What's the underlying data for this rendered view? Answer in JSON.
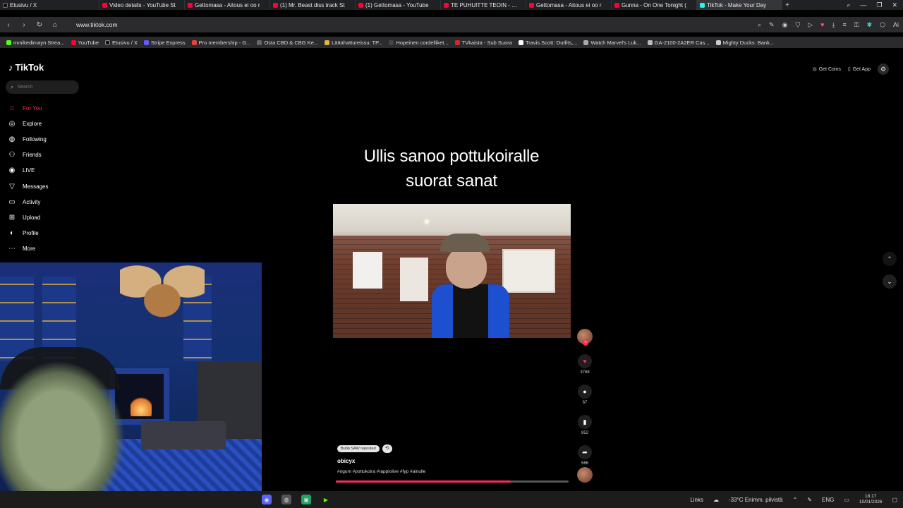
{
  "browser": {
    "tabs": [
      {
        "label": "Etusivu / X",
        "color": "#111111"
      },
      {
        "label": "Video details - YouTube St",
        "color": "#ff0033"
      },
      {
        "label": "Gettomasa - Aitous ei oo r",
        "color": "#ff0033"
      },
      {
        "label": "(1) Mr. Beast diss track St",
        "color": "#ff0033"
      },
      {
        "label": "(1) Gettomasa - YouTube",
        "color": "#ff0033"
      },
      {
        "label": "TE PUHUITTE TEOIN - MIE",
        "color": "#ff0033"
      },
      {
        "label": "Gettomasa - Aitous ei oo r",
        "color": "#ff0033"
      },
      {
        "label": "Gunna - On One Tonight (",
        "color": "#ff0033"
      },
      {
        "label": "TikTok - Make Your Day",
        "color": "#25f4ee",
        "active": true
      }
    ],
    "new_tab": "+",
    "url": "www.tiktok.com",
    "bookmarks": [
      {
        "label": "mmikedimayn Strea...",
        "color": "#53fc18"
      },
      {
        "label": "YouTube",
        "color": "#ff0033"
      },
      {
        "label": "Etusivu / X",
        "color": "#111111"
      },
      {
        "label": "Stripe Express",
        "color": "#635bff"
      },
      {
        "label": "Pro membership - G...",
        "color": "#ea4335"
      },
      {
        "label": "Osta CBD & CBG Ke...",
        "color": "#666666"
      },
      {
        "label": "Lättahattureissu: TP...",
        "color": "#e3b341"
      },
      {
        "label": "Hopeinen cordelliket...",
        "color": "#444444"
      },
      {
        "label": "TVkaista - Sub Suora",
        "color": "#d12a2a"
      },
      {
        "label": "Travis Scott: Outfits,...",
        "color": "#ffffff"
      },
      {
        "label": "Watch Marvel's Luk...",
        "color": "#aaaaaa"
      },
      {
        "label": "GA-2100-2A2ER Cas...",
        "color": "#bbbbbb"
      },
      {
        "label": "Mighty Ducks: Bank...",
        "color": "#cccccc"
      }
    ]
  },
  "tiktok": {
    "logo": "TikTok",
    "search_placeholder": "Search",
    "nav": [
      {
        "label": "For You",
        "icon": "home-icon",
        "active": true
      },
      {
        "label": "Explore",
        "icon": "compass-icon"
      },
      {
        "label": "Following",
        "icon": "following-icon"
      },
      {
        "label": "Friends",
        "icon": "friends-icon"
      },
      {
        "label": "LIVE",
        "icon": "live-icon"
      },
      {
        "label": "Messages",
        "icon": "messages-icon"
      },
      {
        "label": "Activity",
        "icon": "activity-icon"
      },
      {
        "label": "Upload",
        "icon": "upload-icon"
      },
      {
        "label": "Profile",
        "icon": "profile-icon"
      },
      {
        "label": "More",
        "icon": "more-icon"
      }
    ],
    "top_actions": {
      "coins": "Get Coins",
      "app": "Get App"
    },
    "caption_line1": "Ullis sanoo pottukoiralle",
    "caption_line2": "suorat sanat",
    "likes": "3768",
    "comments": "67",
    "saves": "852",
    "shares": "566",
    "repost_label": "Bubb SAW reposted",
    "author": "obicyx",
    "hashtags": "#ogum #pottukoira #rappiolive #fyp #ainulle",
    "progress": 0.75,
    "accent": "#fe2c55"
  },
  "taskbar": {
    "links": "Links",
    "weather": "-33°C  Enimm. pilvistä",
    "lang": "ENG",
    "time": "18.17",
    "date": "10/01/2026"
  }
}
